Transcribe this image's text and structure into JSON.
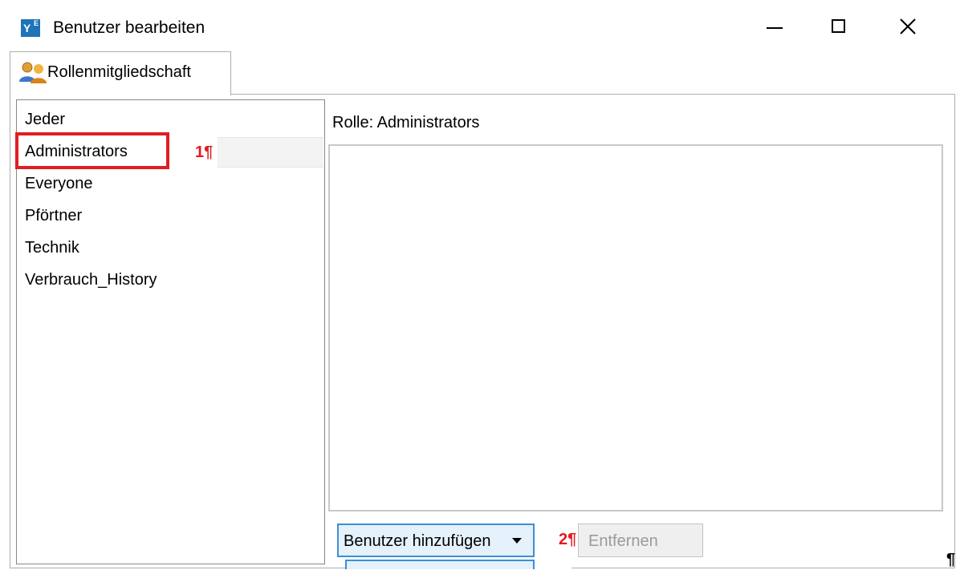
{
  "window": {
    "title": "Benutzer bearbeiten",
    "app_icon": "app-icon-ye",
    "controls": [
      "minimize-icon",
      "maximize-icon",
      "close-icon"
    ]
  },
  "tabs": [
    {
      "label": "Rollenmitgliedschaft",
      "icon": "users-icon",
      "selected": true
    }
  ],
  "roles": {
    "items": [
      "Jeder",
      "Administrators",
      "Everyone",
      "Pförtner",
      "Technik",
      "Verbrauch_History"
    ],
    "selected": "Administrators"
  },
  "detail": {
    "role_label": "Rolle: Administrators",
    "members": []
  },
  "actions": {
    "add_label": "Benutzer hinzufügen",
    "remove_label": "Entfernen",
    "remove_enabled": false
  },
  "annotations": {
    "marker1": "1¶",
    "marker2": "2¶",
    "highlight_color": "#e21c24"
  },
  "trailing_mark": "¶",
  "colors": {
    "accent": "#3c8fd6",
    "button_bg": "#e5f1fb",
    "border": "#adadad"
  }
}
